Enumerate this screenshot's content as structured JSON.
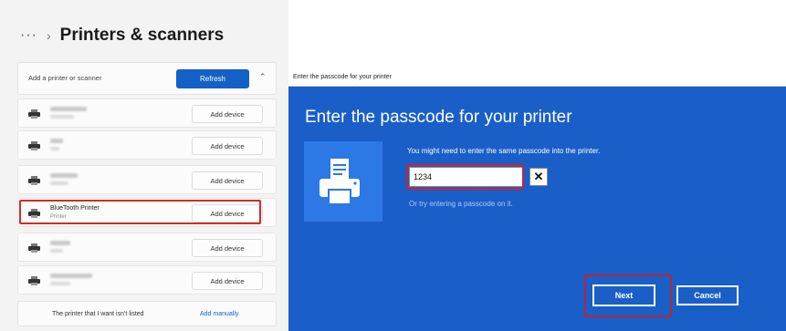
{
  "settings": {
    "breadcrumb_more": "···",
    "breadcrumb_sep": "›",
    "title": "Printers & scanners",
    "add_label": "Add a printer or scanner",
    "refresh_label": "Refresh",
    "devices": [
      {
        "name": "",
        "status": "",
        "button": "Add device"
      },
      {
        "name": "",
        "status": "",
        "button": "Add device"
      },
      {
        "name": "",
        "status": "",
        "button": "Add device"
      },
      {
        "name": "BlueTooth Printer",
        "status": "Printer",
        "button": "Add device"
      },
      {
        "name": "",
        "status": "",
        "button": "Add device"
      },
      {
        "name": "",
        "status": "",
        "button": "Add device"
      }
    ],
    "not_listed": "The printer that I want isn't listed",
    "add_manually": "Add manually"
  },
  "dialog": {
    "window_title": "Enter the passcode for your printer",
    "heading": "Enter the passcode for your printer",
    "instruction": "You might need to enter the same passcode into the printer.",
    "passcode_value": "1234",
    "clear_glyph": "✕",
    "alt_text": "Or try entering a passcode on it.",
    "next_label": "Next",
    "cancel_label": "Cancel"
  },
  "colors": {
    "accent": "#1360c7",
    "dialog_bg": "#1a5ec8",
    "highlight": "#d22a2a"
  }
}
